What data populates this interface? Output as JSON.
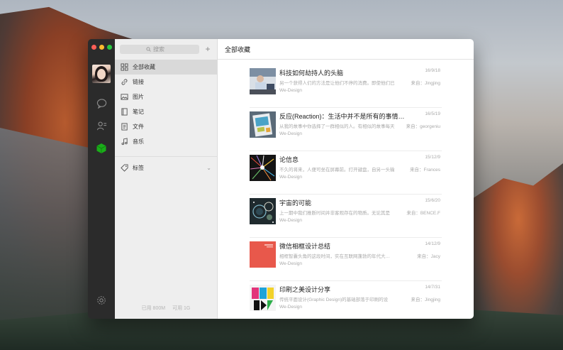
{
  "colors": {
    "rail_bg": "#2b2b2b",
    "sidebar_bg": "#eeeeee",
    "active_item_bg": "#d9d9d9",
    "accent_green": "#1aad19"
  },
  "rail": {
    "icons": [
      "chat-icon",
      "contacts-icon",
      "favorites-icon",
      "settings-icon"
    ]
  },
  "search": {
    "placeholder": "搜索"
  },
  "sidebar": {
    "add_label": "+",
    "items": [
      {
        "label": "全部收藏",
        "icon": "grid-icon",
        "active": true
      },
      {
        "label": "链接",
        "icon": "link-icon"
      },
      {
        "label": "图片",
        "icon": "image-icon"
      },
      {
        "label": "笔记",
        "icon": "note-icon"
      },
      {
        "label": "文件",
        "icon": "file-icon"
      },
      {
        "label": "音乐",
        "icon": "music-icon"
      }
    ],
    "tags_label": "标签",
    "storage": {
      "used": "已用 800M",
      "available": "可用 1G"
    }
  },
  "main": {
    "title": "全部收藏",
    "items": [
      {
        "title": "科技如何劫持人的头脑",
        "excerpt": "另一个获得人们的方法是让他们不停的消费。即使他们已",
        "source": "We-Design",
        "date": "16/9/18",
        "author": "来自：Jingjing",
        "thumb": "tech"
      },
      {
        "title": "反应(Reaction)：生活中并不是所有的事情都那…",
        "excerpt": "从我的故事中你选择了一群相似的人。有相似的故事每天",
        "source": "We-Design",
        "date": "16/5/19",
        "author": "来自：georgeniu",
        "thumb": "reaction"
      },
      {
        "title": "论信息",
        "excerpt": "不久的将来，人便可坐在屏幕前。打开键盘，自另一头输",
        "source": "We-Design",
        "date": "15/12/9",
        "author": "来自：Frances",
        "thumb": "info"
      },
      {
        "title": "宇宙的可能",
        "excerpt": "上一期中我们推断时间并非客观存在的物质。无论其是",
        "source": "We-Design",
        "date": "15/6/20",
        "author": "来自：BENCE.F",
        "thumb": "universe"
      },
      {
        "title": "微信相框设计总结",
        "excerpt": "相框智囊头角的这段时间，实在互联网蓬勃的年代大…",
        "source": "We-Design",
        "date": "14/12/9",
        "author": "来自：Jacy",
        "thumb": "frame"
      },
      {
        "title": "印刷之美设计分享",
        "excerpt": "传统平面设计(Graphic Design)的基础部落于印刷的设",
        "source": "We-Design",
        "date": "14/7/31",
        "author": "来自：Jingjing",
        "thumb": "print"
      }
    ]
  }
}
